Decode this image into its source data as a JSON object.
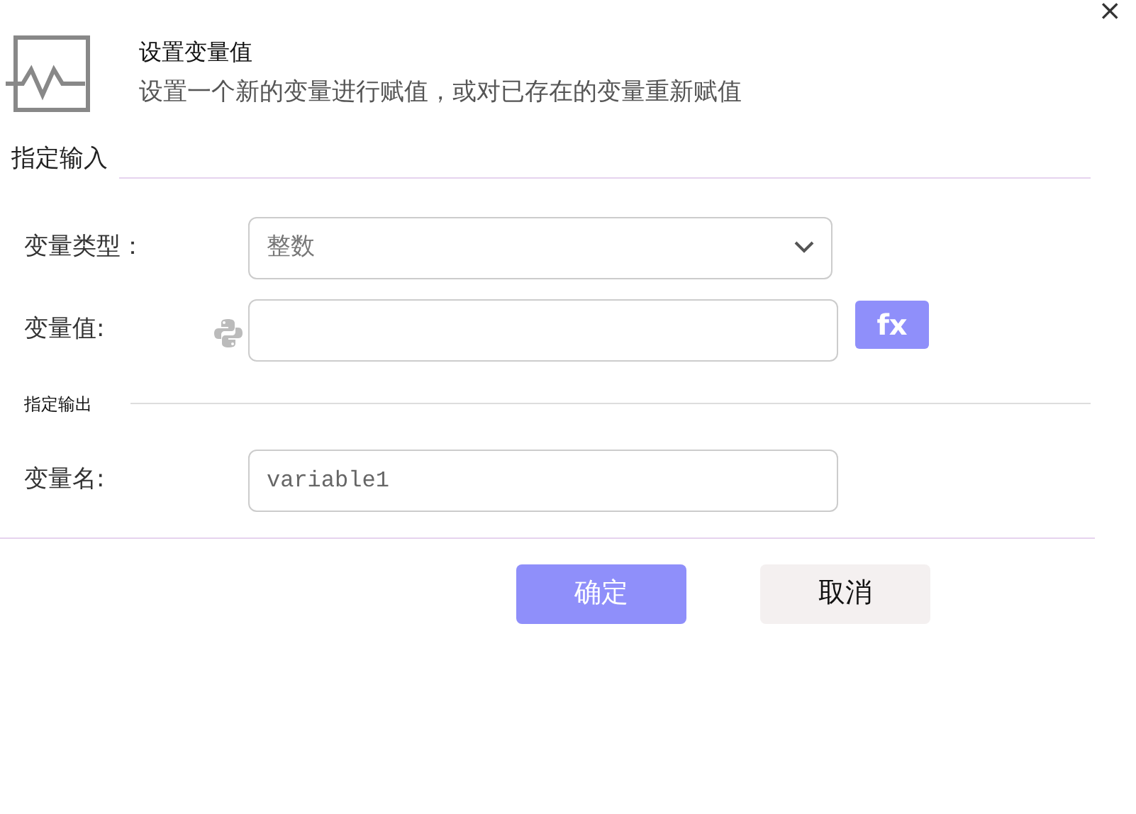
{
  "dialog": {
    "title": "设置变量值",
    "description": "设置一个新的变量进行赋值，或对已存在的变量重新赋值",
    "close": "×"
  },
  "input_section": {
    "title": "指定输入"
  },
  "fields": [
    {
      "kind": "select",
      "label": "变量类型：",
      "value": "整数"
    },
    {
      "kind": "expression",
      "label": "变量值:",
      "button": "fx"
    }
  ],
  "output_section": {
    "title": "指定输出"
  },
  "output_fields": [
    {
      "kind": "text",
      "label": "变量名:",
      "value": "variable1"
    }
  ],
  "buttons": [
    {
      "label": "确定",
      "kind": "primary"
    },
    {
      "label": "取消",
      "kind": "secondary"
    }
  ]
}
